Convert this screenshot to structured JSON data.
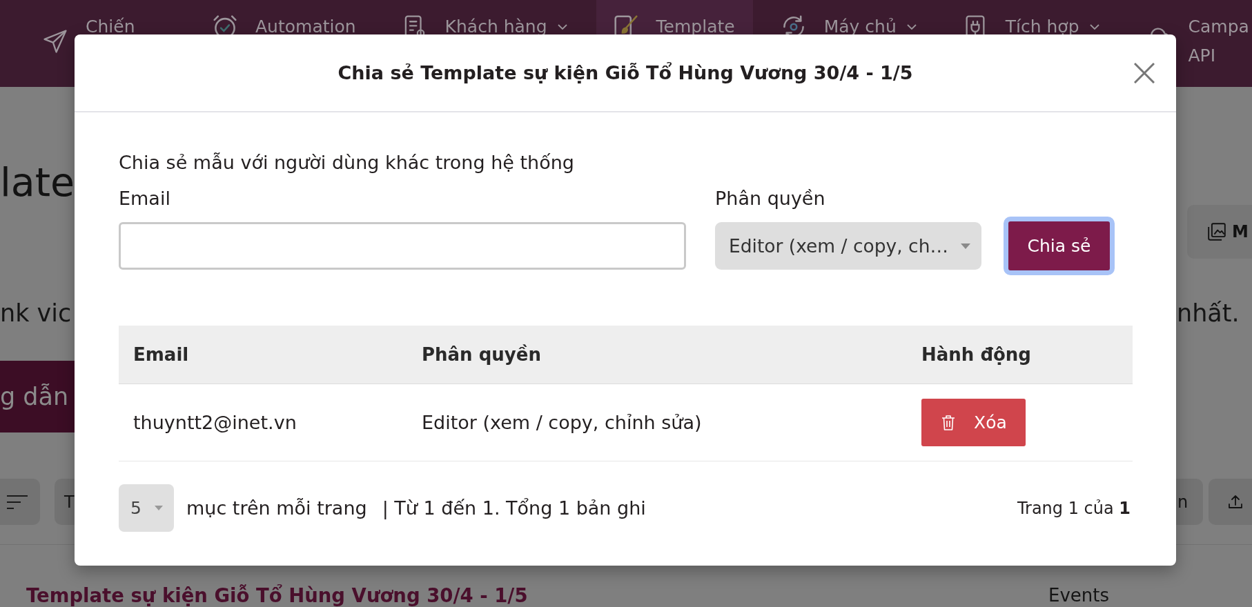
{
  "nav": {
    "items": [
      {
        "kind": "two-line",
        "label": "Chiến",
        "dropdown": false,
        "selected": false
      },
      {
        "kind": "one-line",
        "label": "Automation",
        "dropdown": false,
        "selected": false
      },
      {
        "kind": "one-line",
        "label": "Khách hàng",
        "dropdown": true,
        "selected": false
      },
      {
        "kind": "one-line",
        "label": "Template",
        "dropdown": false,
        "selected": true
      },
      {
        "kind": "one-line",
        "label": "Máy chủ",
        "dropdown": true,
        "selected": false
      },
      {
        "kind": "one-line",
        "label": "Tích hợp",
        "dropdown": true,
        "selected": false
      },
      {
        "kind": "two-line",
        "label": "Campa",
        "second_line": "API",
        "dropdown": false,
        "selected": false
      }
    ]
  },
  "page": {
    "heading": "late",
    "intro_left": "nk vic",
    "intro_right": "nhất.",
    "guide_button": "g dẫn",
    "filter_button": "T",
    "toolbar_button": "M",
    "bottom_button": "n",
    "list_item": {
      "title": "Template sự kiện Giỗ Tổ Hùng Vương 30/4 - 1/5",
      "category": "Events"
    }
  },
  "modal": {
    "title": "Chia sẻ Template sự kiện Giỗ Tổ Hùng Vương 30/4 - 1/5",
    "description": "Chia sẻ mẫu với người dùng khác trong hệ thống",
    "email_field": {
      "label": "Email"
    },
    "role_field": {
      "label": "Phân quyền",
      "value": "Editor (xem / copy, ch…"
    },
    "share_button": {
      "label": "Chia sẻ",
      "focused": true
    },
    "table": {
      "columns": [
        "Email",
        "Phân quyền",
        "Hành động"
      ],
      "rows": [
        {
          "email": "thuyntt2@inet.vn",
          "role": "Editor (xem / copy, chỉnh sửa)",
          "action": "Xóa"
        }
      ]
    },
    "footer": {
      "page_size": "5",
      "page_size_label": "mục trên mỗi trang",
      "range": "| Từ 1 đến 1. Tổng 1 bản ghi",
      "page_info": "Trang 1 của **1**"
    }
  }
}
